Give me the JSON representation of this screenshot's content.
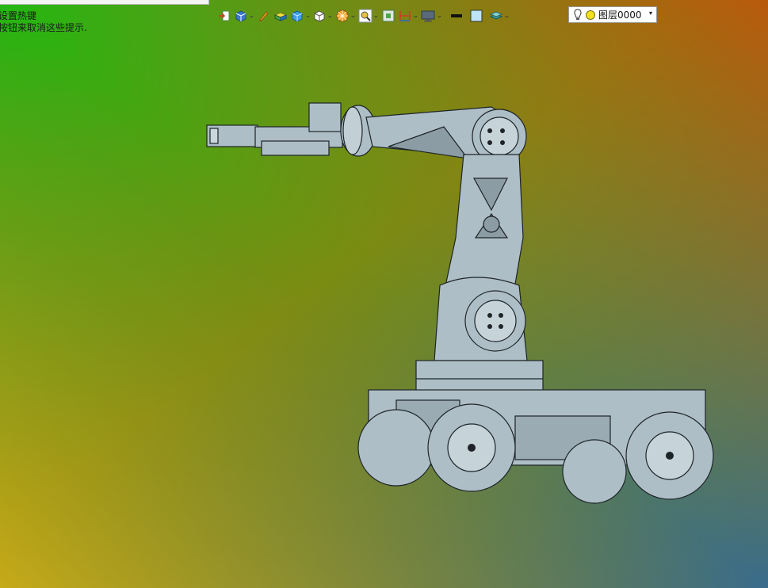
{
  "hints": {
    "line1": "设置热键",
    "line2": "按钮来取消这些提示."
  },
  "toolbar": {
    "buttons": [
      {
        "name": "import-icon",
        "dropdown": false
      },
      {
        "name": "cube-view-icon",
        "dropdown": true
      },
      {
        "name": "pencil-icon",
        "dropdown": false
      },
      {
        "name": "solid-box-icon",
        "dropdown": false
      },
      {
        "name": "blue-cube-icon",
        "dropdown": true
      },
      {
        "name": "white-cube-icon",
        "dropdown": true
      },
      {
        "name": "render-sphere-icon",
        "dropdown": true
      },
      {
        "name": "zoom-icon",
        "dropdown": true
      },
      {
        "name": "fit-view-icon",
        "dropdown": false
      },
      {
        "name": "dimension-icon",
        "dropdown": true
      },
      {
        "name": "monitor-icon",
        "dropdown": true
      },
      {
        "name": "line-color-swatch",
        "dropdown": false
      },
      {
        "name": "fill-color-swatch",
        "dropdown": false
      },
      {
        "name": "layer-stack-icon",
        "dropdown": true
      }
    ],
    "caret": "⌄"
  },
  "layer": {
    "selected": "图层0000",
    "arrow": "▾"
  },
  "colors": {
    "bg_top_left": "#2ab80a",
    "bg_top_right": "#b85a0a",
    "bg_bottom_left": "#c4b416",
    "bg_bottom_right": "#3d7390",
    "model_fill": "#aebec6",
    "model_edge": "#1d2428"
  }
}
